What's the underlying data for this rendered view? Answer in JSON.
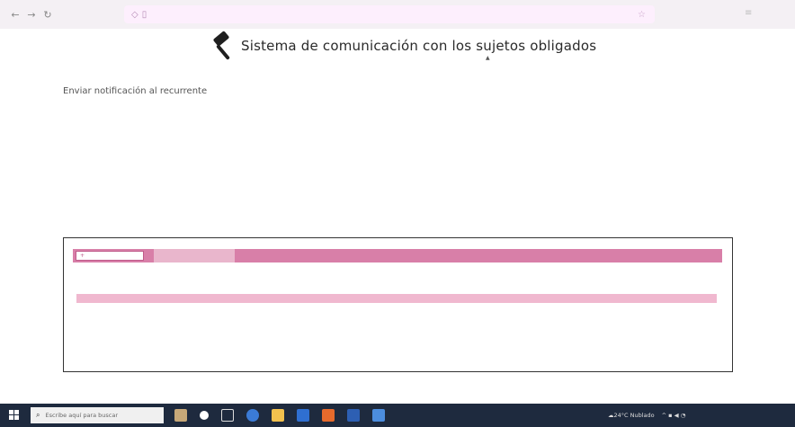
{
  "header": {
    "title": "Sistema de comunicación con los sujetos obligados"
  },
  "colors": {
    "accent": "#d87fa8",
    "accent_light": "#f0b8cf",
    "taskbar": "#1e2a3e"
  },
  "page": {
    "heading": "Enviar notificación al recurrente"
  },
  "taskbar": {
    "search_placeholder": "Escribe aquí para buscar",
    "weather": "24°C Nublado"
  },
  "icons": {
    "app_logo": "gavel-icon",
    "search": "search-icon",
    "windows": "windows-logo-icon"
  }
}
